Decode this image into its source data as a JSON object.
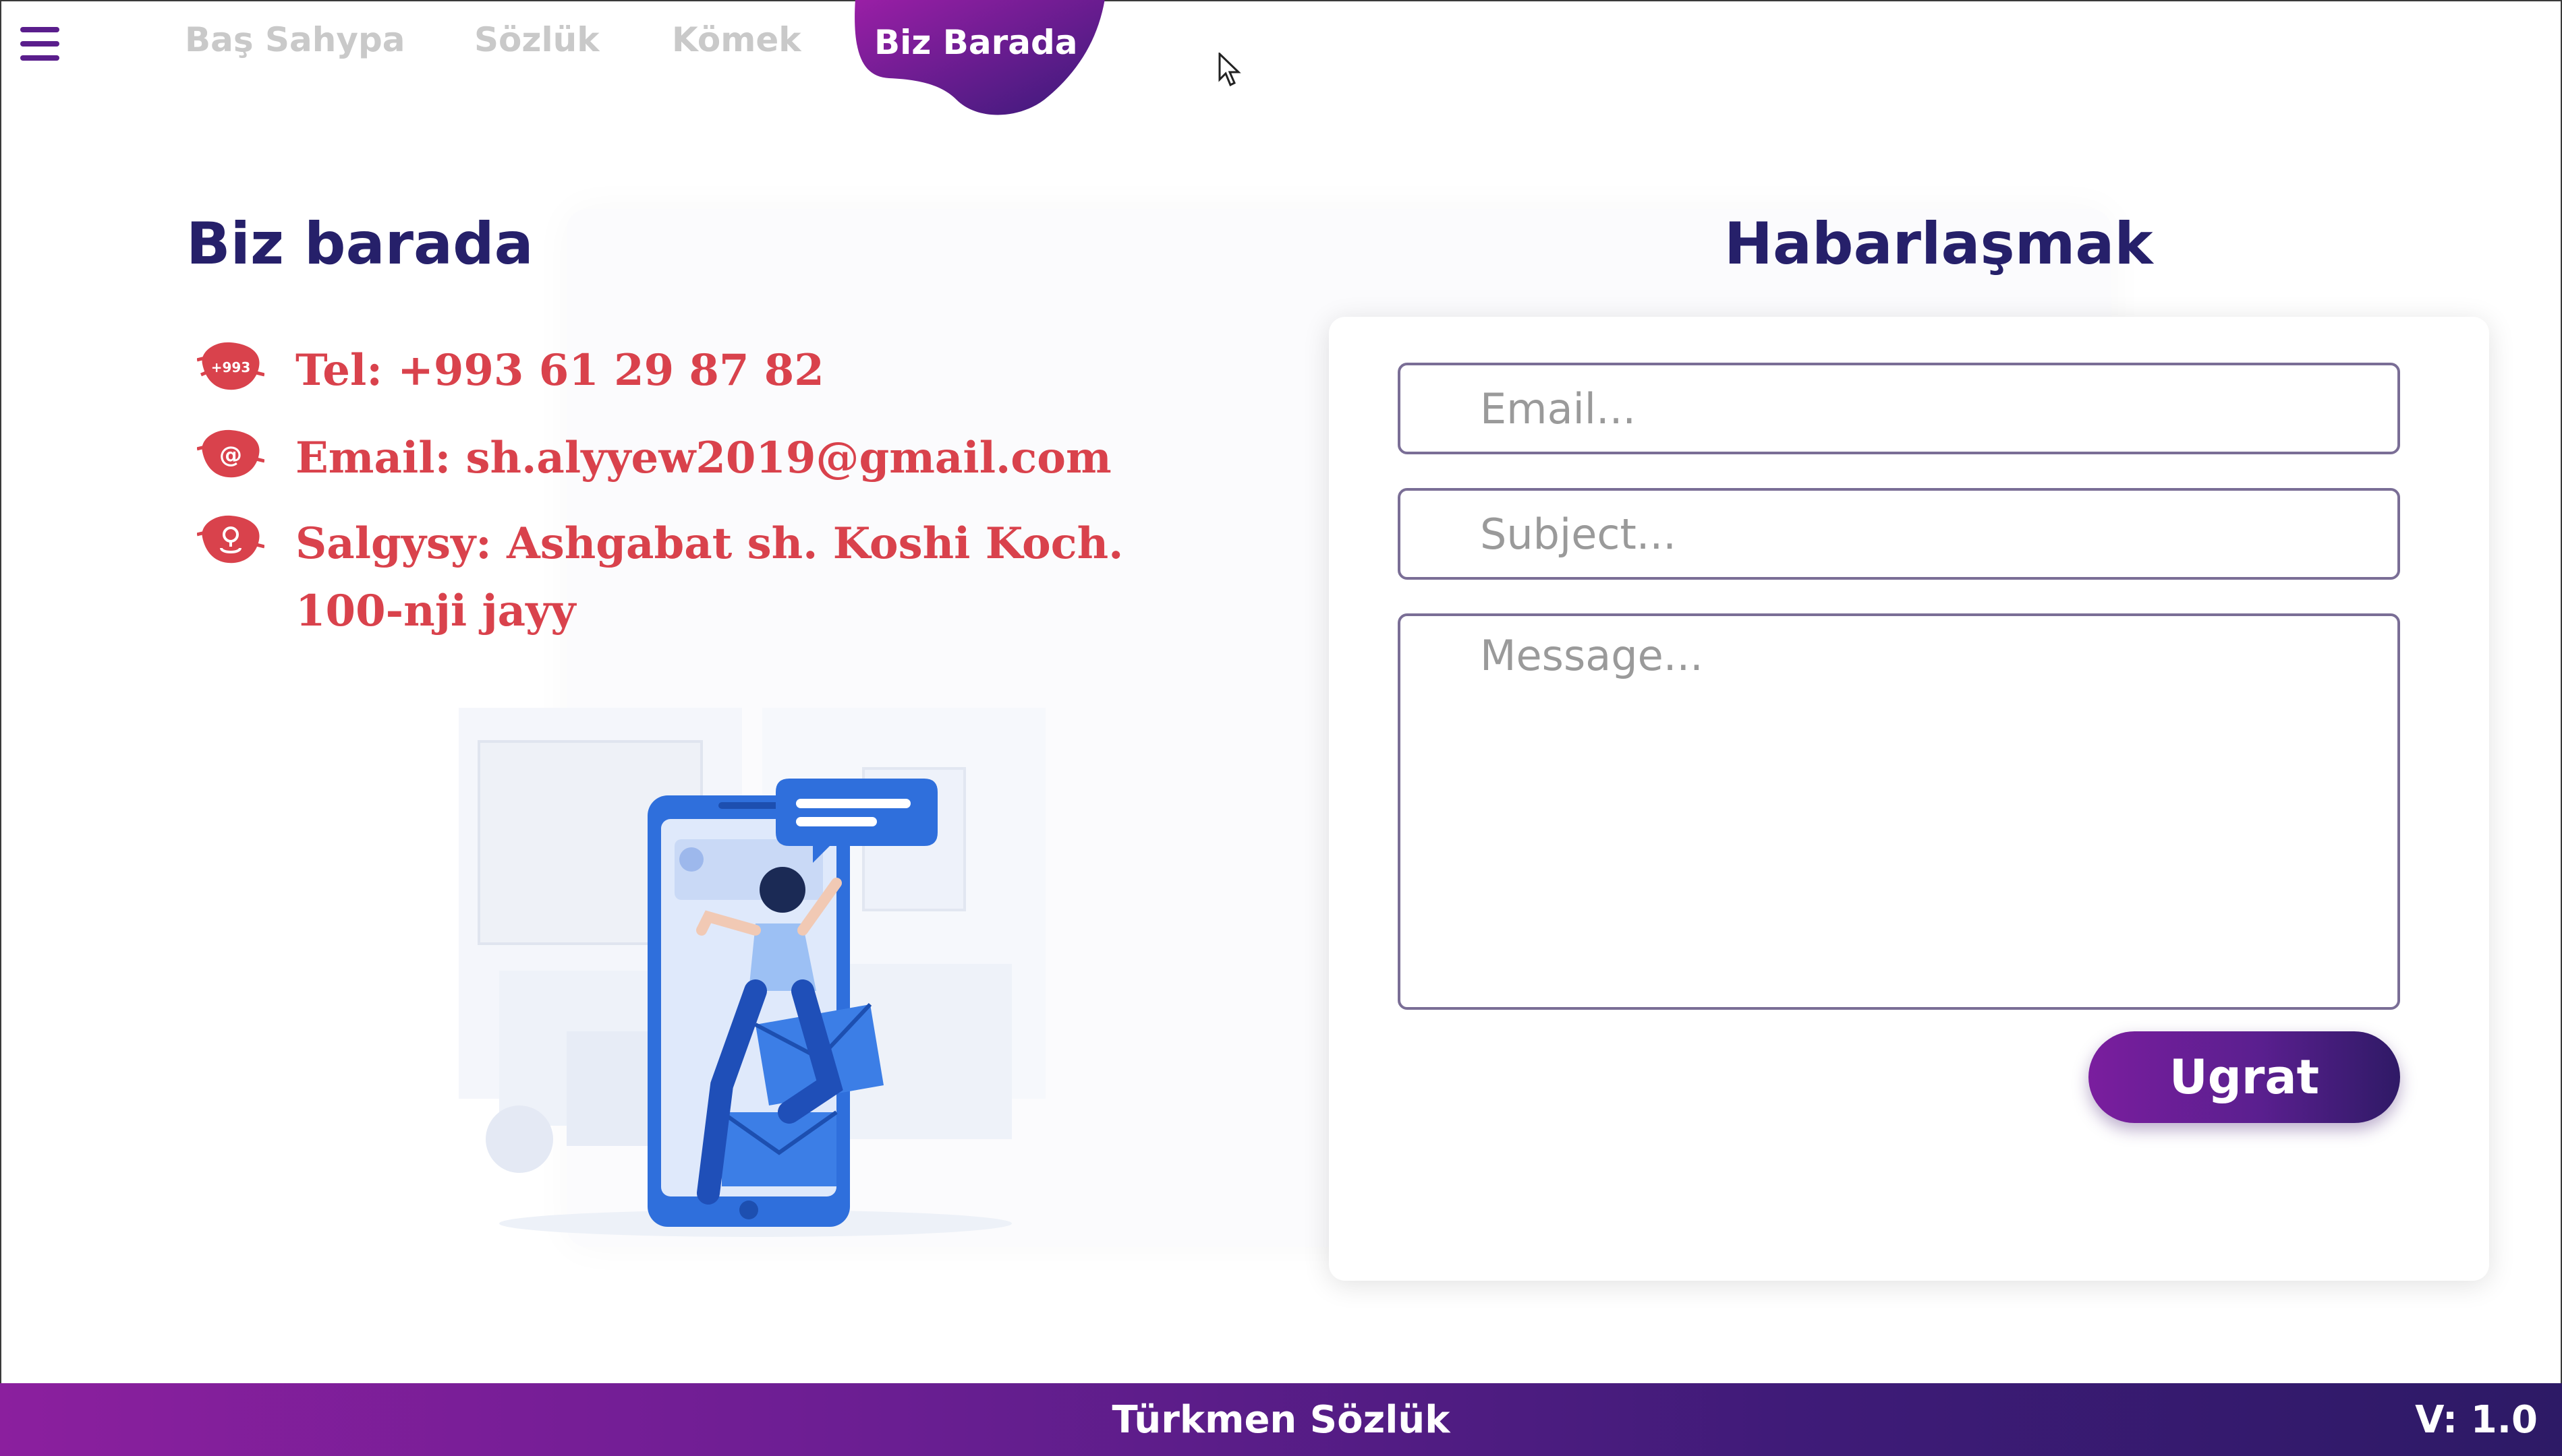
{
  "nav": {
    "items": [
      {
        "label": "Baş Sahypa"
      },
      {
        "label": "Sözlük"
      },
      {
        "label": "Kömek"
      },
      {
        "label": "Biz Barada"
      }
    ],
    "active_index": 3
  },
  "about": {
    "title": "Biz barada",
    "phone": "Tel: +993 61 29 87 82",
    "phone_icon_text": "+993",
    "email": "Email: sh.alyyew2019@gmail.com",
    "address_line1": "Salgysy: Ashgabat sh. Koshi Koch.",
    "address_line2": "100-nji jayy"
  },
  "contact_form": {
    "title": "Habarlaşmak",
    "email_placeholder": "Email...",
    "subject_placeholder": "Subject...",
    "message_placeholder": "Message...",
    "submit_label": "Ugrat"
  },
  "footer": {
    "app_title": "Türkmen Sözlük",
    "version": "V: 1.0"
  },
  "colors": {
    "accent_purple": "#5a1e8c",
    "heading_navy": "#26206a",
    "contact_red": "#d9424c"
  }
}
